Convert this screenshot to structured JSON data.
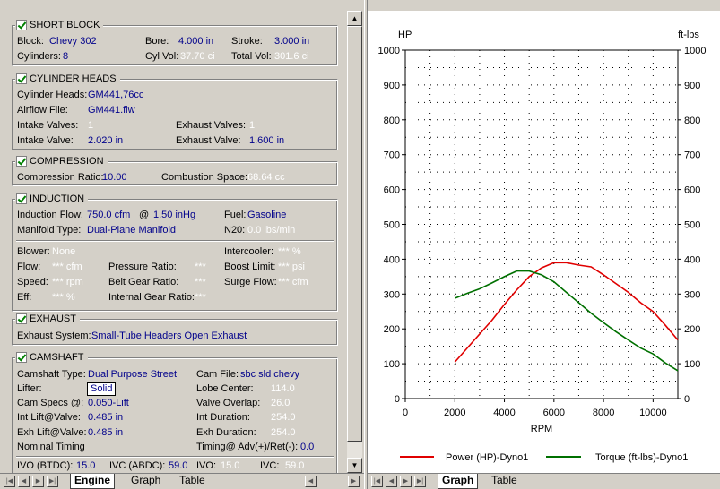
{
  "left_tabs": {
    "labels": [
      "Engine",
      "Graph",
      "Table"
    ]
  },
  "right_tabs": {
    "labels": [
      "Graph",
      "Table"
    ]
  },
  "short_block": {
    "title": "SHORT BLOCK",
    "block_label": "Block:",
    "block": "Chevy 302",
    "bore_label": "Bore:",
    "bore": "4.000 in",
    "stroke_label": "Stroke:",
    "stroke": "3.000 in",
    "cyl_label": "Cylinders:",
    "cyl": "8",
    "cylvol_label": "Cyl Vol:",
    "cylvol": "37.70 ci",
    "totvol_label": "Total Vol:",
    "totvol": "301.6 ci"
  },
  "heads": {
    "title": "CYLINDER HEADS",
    "heads_label": "Cylinder Heads:",
    "heads": "GM441,76cc",
    "airflow_label": "Airflow File:",
    "airflow": "GM441.flw",
    "iv_label": "Intake Valves:",
    "iv": "1",
    "ev_label": "Exhaust Valves:",
    "ev": "1",
    "ivs_label": "Intake Valve:",
    "ivs": "2.020 in",
    "evs_label": "Exhaust Valve:",
    "evs": "1.600 in"
  },
  "compression": {
    "title": "COMPRESSION",
    "ratio_label": "Compression Ratio:",
    "ratio": "10.00",
    "space_label": "Combustion Space:",
    "space": "68.64 cc"
  },
  "induction": {
    "title": "INDUCTION",
    "flow_label": "Induction Flow:",
    "flow": "750.0 cfm",
    "at": "@",
    "pressure": "1.50 inHg",
    "fuel_label": "Fuel:",
    "fuel": "Gasoline",
    "manifold_label": "Manifold Type:",
    "manifold": "Dual-Plane Manifold",
    "n20_label": "N20:",
    "n20": "0.0 lbs/min",
    "blower_label": "Blower:",
    "blower": "None",
    "intercooler_label": "Intercooler:",
    "intercooler": "*** %",
    "bflow_label": "Flow:",
    "bflow": "*** cfm",
    "pratio_label": "Pressure Ratio:",
    "pratio": "***",
    "boost_label": "Boost Limit:",
    "boost": "*** psi",
    "speed_label": "Speed:",
    "speed": "*** rpm",
    "belt_label": "Belt Gear Ratio:",
    "belt": "***",
    "surge_label": "Surge Flow:",
    "surge": "*** cfm",
    "eff_label": "Eff:",
    "eff": "*** %",
    "igr_label": "Internal Gear Ratio:",
    "igr": "***"
  },
  "exhaust": {
    "title": "EXHAUST",
    "system_label": "Exhaust System:",
    "system": "Small-Tube Headers Open Exhaust"
  },
  "camshaft": {
    "title": "CAMSHAFT",
    "type_label": "Camshaft Type:",
    "type": "Dual Purpose Street",
    "file_label": "Cam File:",
    "file": "sbc sld  chevy",
    "lifter_label": "Lifter:",
    "lifter": "Solid",
    "lobe_label": "Lobe Center:",
    "lobe": "114.0",
    "specs_label": "Cam Specs @:",
    "specs": "0.050-Lift",
    "overlap_label": "Valve Overlap:",
    "overlap": "26.0",
    "intlift_label": "Int Lift@Valve:",
    "intlift": "0.485 in",
    "intdur_label": "Int Duration:",
    "intdur": "254.0",
    "exhlift_label": "Exh Lift@Valve:",
    "exhlift": "0.485 in",
    "exhdur_label": "Exh Duration:",
    "exhdur": "254.0",
    "timing_label": "Nominal Timing",
    "adv_label": "Timing@ Adv(+)/Ret(-):",
    "adv": "0.0",
    "ivo_label": "IVO  (BTDC):",
    "ivo": "15.0",
    "ivc_label": "IVC  (ABDC):",
    "ivc": "59.0",
    "ivo2_label": "IVO:",
    "ivo2": "15.0",
    "ivc2_label": "IVC:",
    "ivc2": "59.0"
  },
  "chart_data": {
    "type": "line",
    "ylabel_left": "HP",
    "ylabel_right": "ft-lbs",
    "xlabel": "RPM",
    "xlim": [
      0,
      11000
    ],
    "ylim": [
      0,
      1000
    ],
    "xticks": [
      0,
      2000,
      4000,
      6000,
      8000,
      10000
    ],
    "yticks": [
      0,
      100,
      200,
      300,
      400,
      500,
      600,
      700,
      800,
      900,
      1000
    ],
    "grid": true,
    "legend_position": "bottom",
    "series": [
      {
        "name": "Power (HP)-Dyno1",
        "color": "#e00000",
        "x": [
          2000,
          2500,
          3000,
          3500,
          4000,
          4500,
          5000,
          5500,
          6000,
          6500,
          7000,
          7500,
          8000,
          8500,
          9000,
          9500,
          10000,
          10500,
          11000
        ],
        "y": [
          105,
          145,
          185,
          225,
          270,
          312,
          350,
          375,
          390,
          390,
          383,
          378,
          355,
          330,
          305,
          275,
          250,
          210,
          168
        ]
      },
      {
        "name": "Torque (ft-lbs)-Dyno1",
        "color": "#007000",
        "x": [
          2000,
          2500,
          3000,
          3500,
          4000,
          4500,
          5000,
          5500,
          6000,
          6500,
          7000,
          7500,
          8000,
          8500,
          9000,
          9500,
          10000,
          10500,
          11000
        ],
        "y": [
          288,
          302,
          315,
          332,
          350,
          366,
          366,
          355,
          335,
          305,
          275,
          245,
          218,
          192,
          168,
          145,
          128,
          102,
          80
        ]
      }
    ]
  }
}
